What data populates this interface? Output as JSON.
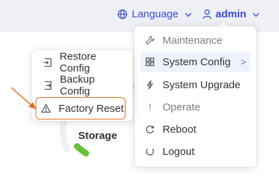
{
  "header": {
    "language_label": "Language",
    "user_label": "admin"
  },
  "gauge": {
    "value_text": "5%",
    "label": "Storage"
  },
  "main_menu": {
    "items": [
      {
        "label": "Maintenance",
        "icon": "wrench-icon",
        "type": "group"
      },
      {
        "label": "System Config",
        "icon": "grid-icon",
        "type": "submenu",
        "tail": ">"
      },
      {
        "label": "System Upgrade",
        "icon": "bolt-icon",
        "type": "item"
      },
      {
        "label": "Operate",
        "icon": "exclamation-icon",
        "type": "group"
      },
      {
        "label": "Reboot",
        "icon": "refresh-icon",
        "type": "item"
      },
      {
        "label": "Logout",
        "icon": "power-icon",
        "type": "item"
      }
    ]
  },
  "sub_menu": {
    "items": [
      {
        "label": "Restore Config",
        "icon": "import-icon"
      },
      {
        "label": "Backup Config",
        "icon": "export-icon"
      },
      {
        "label": "Factory Reset",
        "icon": "warning-icon"
      }
    ]
  },
  "colors": {
    "accent": "#3a4ad8",
    "highlight": "#e46d1d",
    "gauge_fill": "#67c23a"
  }
}
